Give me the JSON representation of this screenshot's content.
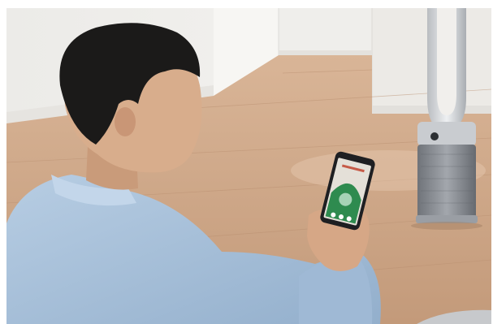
{
  "photo": {
    "subject": "man-using-phone-app",
    "device": "tower-purifier-fan",
    "colors": {
      "wall": "#f1efec",
      "floor": "#cfa788",
      "shirt": "#a9c2dc",
      "hair": "#1b1a19",
      "skin": "#d8ad8c",
      "fan_silver": "#cfd2d5",
      "fan_base": "#8d9197",
      "phone_screen": "#e4e0d8",
      "app_arc": "#2e8b4f"
    }
  }
}
